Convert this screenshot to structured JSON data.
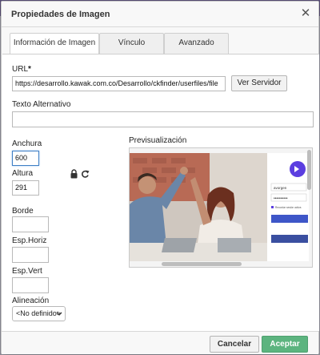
{
  "dialog": {
    "title": "Propiedades de Imagen",
    "close_glyph": "✕",
    "tabs": [
      {
        "label": "Información de Imagen",
        "active": true
      },
      {
        "label": "Vínculo",
        "active": false
      },
      {
        "label": "Avanzado",
        "active": false
      }
    ]
  },
  "form": {
    "url_label": "URL",
    "url_required_mark": "*",
    "url_value": "https://desarrollo.kawak.com.co/Desarrollo/ckfinder/userfiles/file",
    "browse_server_label": "Ver Servidor",
    "alt_label": "Texto Alternativo",
    "alt_value": "",
    "width_label": "Anchura",
    "width_value": "600",
    "height_label": "Altura",
    "height_value": "291",
    "lock_icon": "lock-icon",
    "reset_icon": "reset-size-icon",
    "border_label": "Borde",
    "border_value": "",
    "hspace_label": "Esp.Horiz",
    "hspace_value": "",
    "vspace_label": "Esp.Vert",
    "vspace_value": "",
    "align_label": "Alineación",
    "align_selected": "<No definido>",
    "preview_label": "Previsualización"
  },
  "preview_image": {
    "login_field_1": "avorgen",
    "login_field_2": "••••••••••",
    "remember_text": "Recordar sesión activa"
  },
  "footer": {
    "cancel_label": "Cancelar",
    "accept_label": "Aceptar"
  },
  "colors": {
    "accept_bg": "#5cb47f",
    "focus_border": "#3f7fc5",
    "brand_purple": "#5b3ee0"
  }
}
